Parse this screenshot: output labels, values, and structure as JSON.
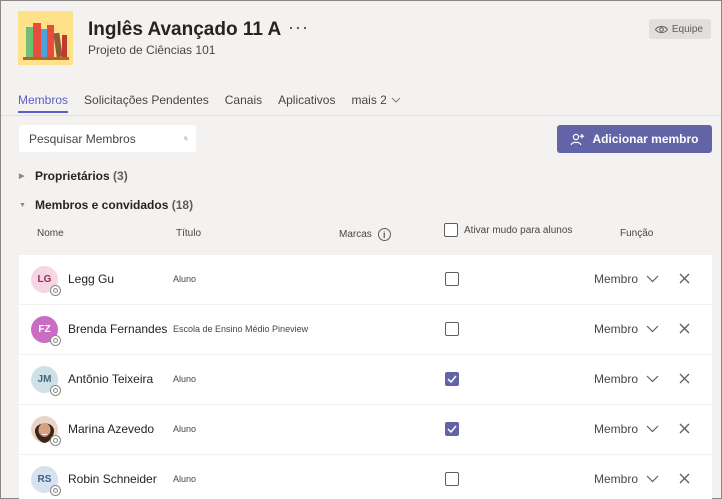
{
  "team": {
    "name": "Inglês Avançado 11 A",
    "more": "···",
    "subtitle": "Projeto de Ciências 101",
    "badge": "Equipe"
  },
  "tabs": [
    {
      "label": "Membros",
      "active": true
    },
    {
      "label": "Solicitações Pendentes"
    },
    {
      "label": "Canais"
    },
    {
      "label": "Aplicativos"
    },
    {
      "label": "mais 2"
    }
  ],
  "search": {
    "placeholder": "Pesquisar Membros"
  },
  "add_member_label": "Adicionar membro",
  "sections": {
    "owners": {
      "label": "Proprietários",
      "count": "(3)"
    },
    "members": {
      "label": "Membros e convidados",
      "count": "(18)"
    }
  },
  "columns": {
    "name": "Nome",
    "title": "Título",
    "tags": "Marcas",
    "mute": "Ativar mudo para alunos",
    "role": "Função"
  },
  "members": [
    {
      "initials": "LG",
      "name": "Legg Gu",
      "title": "Aluno",
      "muted": false,
      "role": "Membro",
      "avatar_bg": "#f4d7e3",
      "avatar_fg": "#9b2c5b"
    },
    {
      "initials": "FZ",
      "name": "Brenda Fernandes",
      "title": "Escola de Ensino Médio Pineview",
      "muted": false,
      "role": "Membro",
      "avatar_bg": "#c86dc3",
      "avatar_fg": "#ffffff"
    },
    {
      "initials": "JM",
      "name": "Antônio Teixeira",
      "title": "Aluno",
      "muted": true,
      "role": "Membro",
      "avatar_bg": "#cfe1e6",
      "avatar_fg": "#3c6b78"
    },
    {
      "initials": "",
      "name": "Marina Azevedo",
      "title": "Aluno",
      "muted": true,
      "role": "Membro",
      "avatar_bg": "photo",
      "avatar_fg": "#ffffff"
    },
    {
      "initials": "RS",
      "name": "Robin Schneider",
      "title": "Aluno",
      "muted": false,
      "role": "Membro",
      "avatar_bg": "#d6e2f0",
      "avatar_fg": "#3f5d86"
    }
  ],
  "colors": {
    "accent": "#6264a7",
    "tab_active": "#5b5fc7"
  }
}
